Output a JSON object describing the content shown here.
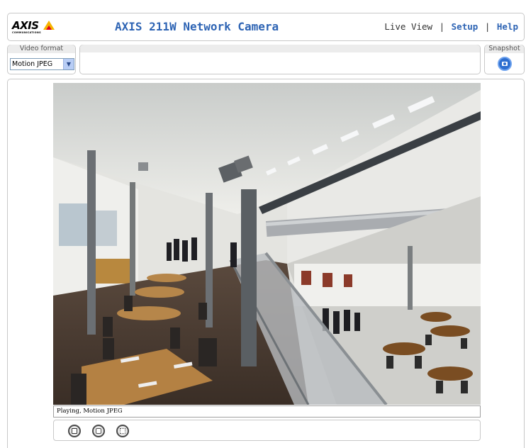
{
  "header": {
    "logo_text": "AXIS",
    "logo_subtext": "COMMUNICATIONS",
    "title": "AXIS 211W Network Camera",
    "nav": {
      "live_view": "Live View",
      "separator": "|",
      "setup": "Setup",
      "help": "Help"
    }
  },
  "video_format": {
    "legend": "Video format",
    "selected": "Motion JPEG"
  },
  "snapshot": {
    "legend": "Snapshot"
  },
  "player": {
    "status": "Playing, Motion JPEG"
  },
  "icons": {
    "snapshot": "camera-icon",
    "stop": "stop-icon",
    "snapshot_small": "camera-icon",
    "fullscreen": "fullscreen-icon",
    "select_arrow": "chevron-down-icon"
  },
  "colors": {
    "title_blue": "#2e64b4",
    "link_blue": "#2e64b4",
    "logo_yellow": "#f5b400",
    "logo_red": "#e2001a",
    "panel_border": "#c8c8c8"
  }
}
